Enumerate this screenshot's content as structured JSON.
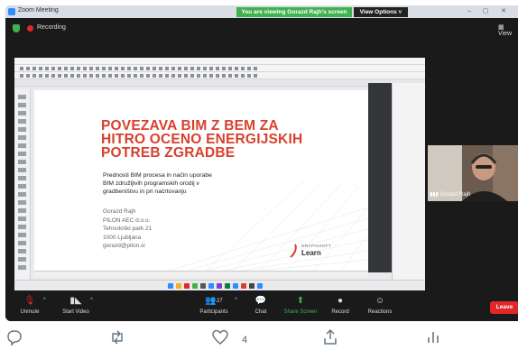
{
  "window": {
    "title": "Zoom Meeting",
    "viewing_banner": "You are viewing Gorazd Rajh's screen",
    "view_options": "View Options ˅"
  },
  "status": {
    "recording_label": "Recording",
    "view_label": "View"
  },
  "slide": {
    "title_lines": [
      "POVEZAVA BIM Z BEM ZA",
      "HITRO OCENO ENERGIJSKIH",
      "POTREB ZGRADBE"
    ],
    "subtitle_lines": [
      "Prednosti BIM procesa in način uporabe",
      "BIM združljivih programskih orodij v",
      "gradbeništvu in pri načrtovanju"
    ],
    "author_lines": [
      "Gorazd Rajh",
      "PILON AEC d.o.o.",
      "Tehnološki park 21",
      "1000 Ljubljana",
      "gorazd@pilon.si"
    ],
    "logo_small": "GRAPHISOFT",
    "logo_big": "Learn"
  },
  "participant": {
    "name": "Gorazd Rajh"
  },
  "toolbar": {
    "unmute": "Unmute",
    "start_video": "Start Video",
    "participants": "Participants",
    "participants_count": "27",
    "chat": "Chat",
    "share_screen": "Share Screen",
    "record": "Record",
    "reactions": "Reactions",
    "leave": "Leave"
  },
  "tweet_actions": {
    "like_count": "4",
    "icons": [
      "reply-icon",
      "retweet-icon",
      "like-icon",
      "share-icon",
      "analytics-icon"
    ]
  },
  "colors": {
    "slide_title": "#d8402e",
    "viewing_banner": "#3fb24f",
    "share_screen": "#3fb24f",
    "leave": "#e02828",
    "zoom_bg": "#1a1a1a"
  }
}
